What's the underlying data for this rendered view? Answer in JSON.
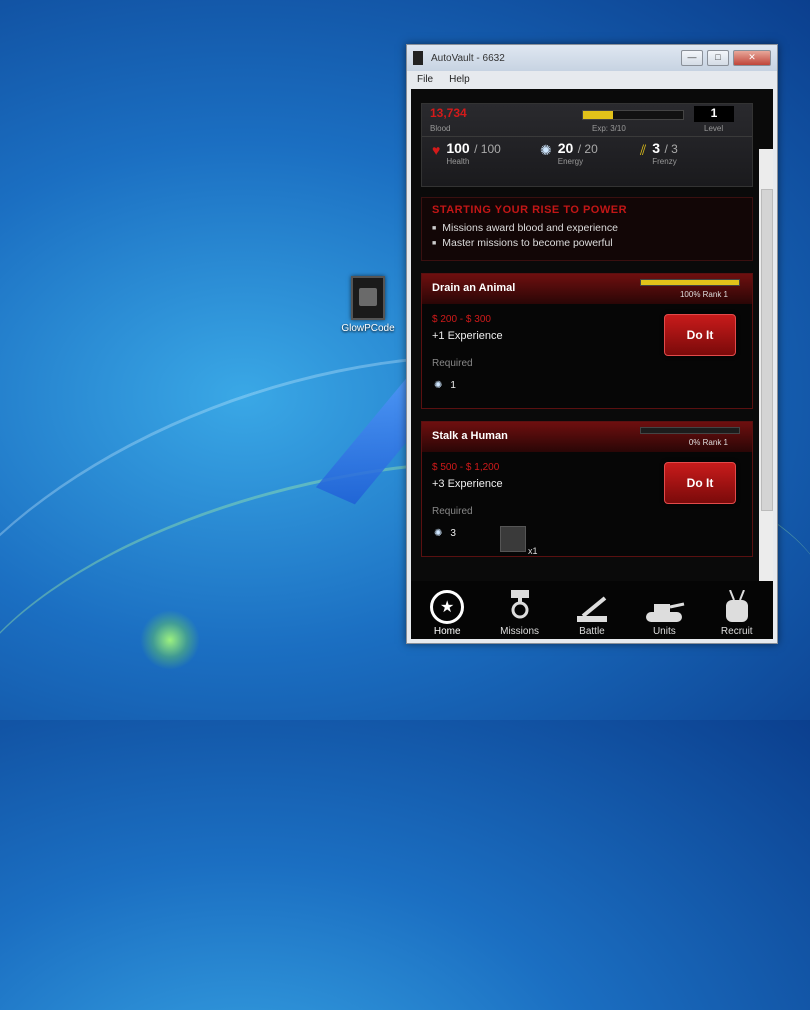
{
  "desktop": {
    "icon_label": "GlowPCode"
  },
  "window": {
    "title": "AutoVault - 6632",
    "menu": [
      "File",
      "Help"
    ],
    "min_symbol": "—",
    "max_symbol": "□",
    "close_symbol": "✕"
  },
  "stats": {
    "blood_value": "13,734",
    "blood_label": "Blood",
    "exp_label": "Exp: 3/10",
    "exp_progress": 0.3,
    "level_value": "1",
    "level_label": "Level",
    "health": {
      "value": "100",
      "max": "/ 100",
      "label": "Health"
    },
    "energy": {
      "value": "20",
      "max": "/ 20",
      "label": "Energy"
    },
    "frenzy": {
      "value": "3",
      "max": "/ 3",
      "label": "Frenzy"
    }
  },
  "intro": {
    "heading": "STARTING YOUR RISE TO POWER",
    "bullets": [
      "Missions award blood and experience",
      "Master missions to become powerful"
    ]
  },
  "missions": [
    {
      "title": "Drain an Animal",
      "progress": 1.0,
      "rank_label": "100% Rank 1",
      "reward": "$ 200 - $ 300",
      "experience": "+1 Experience",
      "required_label": "Required",
      "energy_required": "1",
      "button": "Do It"
    },
    {
      "title": "Stalk a Human",
      "progress": 0.0,
      "rank_label": "0% Rank 1",
      "reward": "$ 500 - $ 1,200",
      "experience": "+3 Experience",
      "required_label": "Required",
      "energy_required": "3",
      "item_count": "x1",
      "button": "Do It"
    }
  ],
  "nav": {
    "home": "Home",
    "missions": "Missions",
    "battle": "Battle",
    "units": "Units",
    "recruit": "Recruit"
  }
}
